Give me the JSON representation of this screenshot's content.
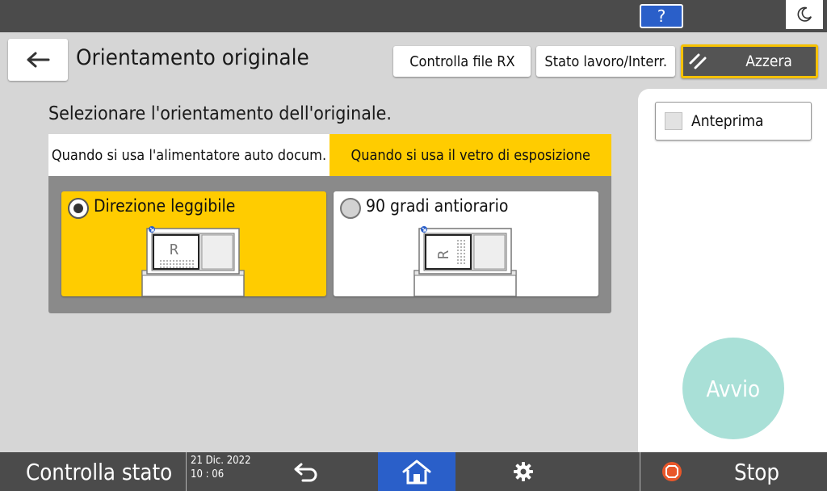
{
  "topbar": {
    "help_label": "?",
    "night_icon": "moon-icon"
  },
  "header": {
    "back_icon": "arrow-left-icon",
    "title": "Orientamento originale",
    "check_rx_label": "Controlla file RX",
    "job_status_label": "Stato lavoro/Interr.",
    "reset_label": "Azzera",
    "reset_icon": "reset-slash-icon"
  },
  "main": {
    "instruction": "Selezionare l'orientamento dell'originale.",
    "tabs": [
      {
        "label": "Quando si usa l'alimentatore auto docum.",
        "selected": false
      },
      {
        "label": "Quando si usa il vetro di esposizione",
        "selected": true
      }
    ],
    "options": [
      {
        "label": "Direzione leggibile",
        "selected": true,
        "icon": "scanner-readable-icon"
      },
      {
        "label": "90 gradi antiorario",
        "selected": false,
        "icon": "scanner-rotated-icon"
      }
    ]
  },
  "side": {
    "preview_label": "Anteprima",
    "start_label": "Avvio"
  },
  "bottombar": {
    "status_label": "Controlla stato",
    "date": "21 Dic. 2022",
    "time": "10 : 06",
    "stop_label": "Stop",
    "icons": [
      "undo-icon",
      "home-icon",
      "gear-icon",
      "stop-icon"
    ]
  },
  "colors": {
    "accent_yellow": "#ffcc00",
    "help_blue": "#2a5fc9",
    "start_teal": "#a9e0d7",
    "stop_orange": "#e8572a",
    "bar_gray": "#4b4b4b"
  }
}
